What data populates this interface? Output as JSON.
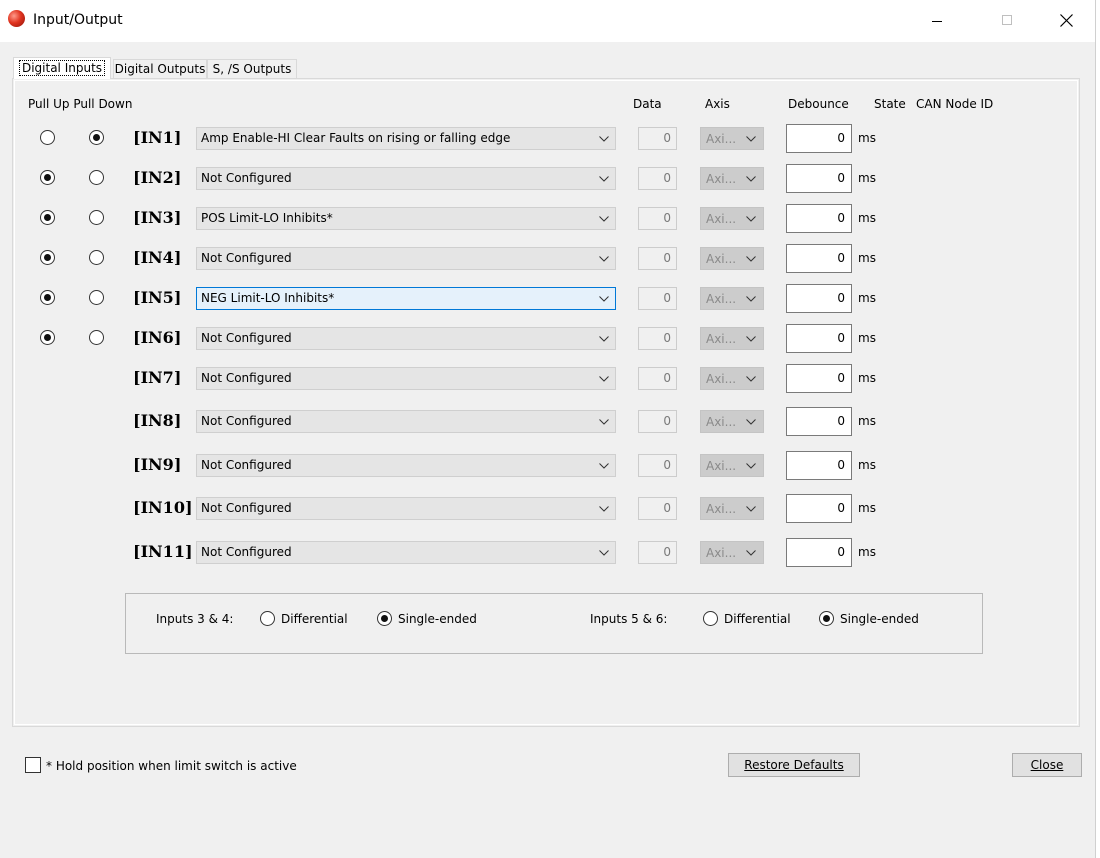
{
  "window": {
    "title": "Input/Output"
  },
  "tabs": [
    "Digital Inputs",
    "Digital Outputs",
    "S, /S Outputs"
  ],
  "headers": {
    "pull_up_pull_down": "Pull Up Pull Down",
    "data": "Data",
    "axis": "Axis",
    "debounce": "Debounce",
    "state": "State",
    "can_node_id": "CAN Node ID"
  },
  "inputs": [
    {
      "label": "[IN1]",
      "function": "Amp Enable-HI Clear Faults on rising or falling edge",
      "data": "0",
      "axis": "Axi...",
      "debounce": "0",
      "unit": "ms",
      "pull": "down"
    },
    {
      "label": "[IN2]",
      "function": "Not Configured",
      "data": "0",
      "axis": "Axi...",
      "debounce": "0",
      "unit": "ms",
      "pull": "up"
    },
    {
      "label": "[IN3]",
      "function": "POS Limit-LO Inhibits*",
      "data": "0",
      "axis": "Axi...",
      "debounce": "0",
      "unit": "ms",
      "pull": "up"
    },
    {
      "label": "[IN4]",
      "function": "Not Configured",
      "data": "0",
      "axis": "Axi...",
      "debounce": "0",
      "unit": "ms",
      "pull": "up"
    },
    {
      "label": "[IN5]",
      "function": "NEG Limit-LO Inhibits*",
      "data": "0",
      "axis": "Axi...",
      "debounce": "0",
      "unit": "ms",
      "pull": "up"
    },
    {
      "label": "[IN6]",
      "function": "Not Configured",
      "data": "0",
      "axis": "Axi...",
      "debounce": "0",
      "unit": "ms",
      "pull": "up"
    },
    {
      "label": "[IN7]",
      "function": "Not Configured",
      "data": "0",
      "axis": "Axi...",
      "debounce": "0",
      "unit": "ms",
      "pull": null
    },
    {
      "label": "[IN8]",
      "function": "Not Configured",
      "data": "0",
      "axis": "Axi...",
      "debounce": "0",
      "unit": "ms",
      "pull": null
    },
    {
      "label": "[IN9]",
      "function": "Not Configured",
      "data": "0",
      "axis": "Axi...",
      "debounce": "0",
      "unit": "ms",
      "pull": null
    },
    {
      "label": "[IN10]",
      "function": "Not Configured",
      "data": "0",
      "axis": "Axi...",
      "debounce": "0",
      "unit": "ms",
      "pull": null
    },
    {
      "label": "[IN11]",
      "function": "Not Configured",
      "data": "0",
      "axis": "Axi...",
      "debounce": "0",
      "unit": "ms",
      "pull": null
    }
  ],
  "input_modes": [
    {
      "label": "Inputs 3 & 4:",
      "options": [
        "Differential",
        "Single-ended"
      ],
      "selected": "Single-ended"
    },
    {
      "label": "Inputs 5 & 6:",
      "options": [
        "Differential",
        "Single-ended"
      ],
      "selected": "Single-ended"
    }
  ],
  "hold_position": {
    "label": "* Hold position when limit switch is active",
    "checked": false
  },
  "buttons": {
    "restore_defaults": "Restore Defaults",
    "close": "Close"
  }
}
